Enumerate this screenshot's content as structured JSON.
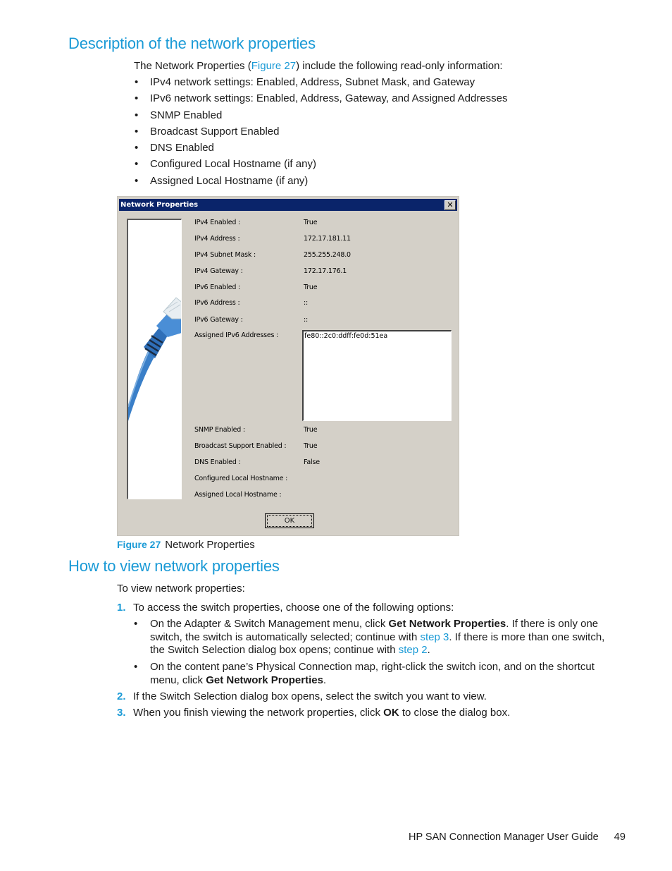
{
  "section1": {
    "heading": "Description of the network properties",
    "intro_before": "The Network Properties (",
    "intro_link": "Figure 27",
    "intro_after": ") include the following read-only information:",
    "bullets": [
      "IPv4 network settings: Enabled, Address, Subnet Mask, and Gateway",
      "IPv6 network settings: Enabled, Address, Gateway, and Assigned Addresses",
      "SNMP Enabled",
      "Broadcast Support Enabled",
      "DNS Enabled",
      "Configured Local Hostname (if any)",
      "Assigned Local Hostname (if any)"
    ]
  },
  "dialog": {
    "title": "Network Properties",
    "close_glyph": "✕",
    "image_icon": "network-cable-image",
    "properties": [
      {
        "label": "IPv4 Enabled :",
        "value": "True"
      },
      {
        "label": "IPv4 Address :",
        "value": "172.17.181.11"
      },
      {
        "label": "IPv4 Subnet Mask :",
        "value": "255.255.248.0"
      },
      {
        "label": "IPv4 Gateway :",
        "value": "172.17.176.1"
      },
      {
        "label": "IPv6 Enabled :",
        "value": "True"
      },
      {
        "label": "IPv6 Address :",
        "value": "::"
      },
      {
        "label": "IPv6 Gateway :",
        "value": "::"
      },
      {
        "label": "Assigned IPv6 Addresses :",
        "value": ""
      }
    ],
    "assigned_ipv6_list": [
      "fe80::2c0:ddff:fe0d:51ea"
    ],
    "properties2": [
      {
        "label": "SNMP Enabled :",
        "value": "True"
      },
      {
        "label": "Broadcast Support Enabled :",
        "value": "True"
      },
      {
        "label": "DNS Enabled :",
        "value": "False"
      },
      {
        "label": "Configured Local Hostname :",
        "value": ""
      },
      {
        "label": "Assigned Local Hostname :",
        "value": ""
      }
    ],
    "ok_label": "OK"
  },
  "figure": {
    "number": "Figure 27",
    "caption": "Network Properties"
  },
  "section2": {
    "heading": "How to view network properties",
    "intro": "To view network properties:",
    "steps": [
      {
        "num": "1.",
        "text": "To access the switch properties, choose one of the following options:",
        "sub": [
          {
            "line1_a": "On the Adapter & Switch Management menu, click ",
            "line1_b": "Get Network Properties",
            "line1_c": ". If there is only one",
            "line2_a": "switch, the switch is automatically selected; continue with ",
            "line2_link": "step 3",
            "line2_b": ". If there is more than one switch,",
            "line3_a": "the Switch Selection dialog box opens; continue with ",
            "line3_link": "step 2",
            "line3_b": "."
          },
          {
            "line1": "On the content pane’s Physical Connection map, right-click the switch icon, and on the shortcut",
            "line2_a": "menu, click ",
            "line2_b": "Get Network Properties",
            "line2_c": "."
          }
        ]
      },
      {
        "num": "2.",
        "text": "If the Switch Selection dialog box opens, select the switch you want to view."
      },
      {
        "num": "3.",
        "text_a": "When you finish viewing the network properties, click ",
        "text_b": "OK",
        "text_c": " to close the dialog box."
      }
    ]
  },
  "footer": {
    "guide_title": "HP SAN Connection Manager User Guide",
    "page_number": "49"
  }
}
